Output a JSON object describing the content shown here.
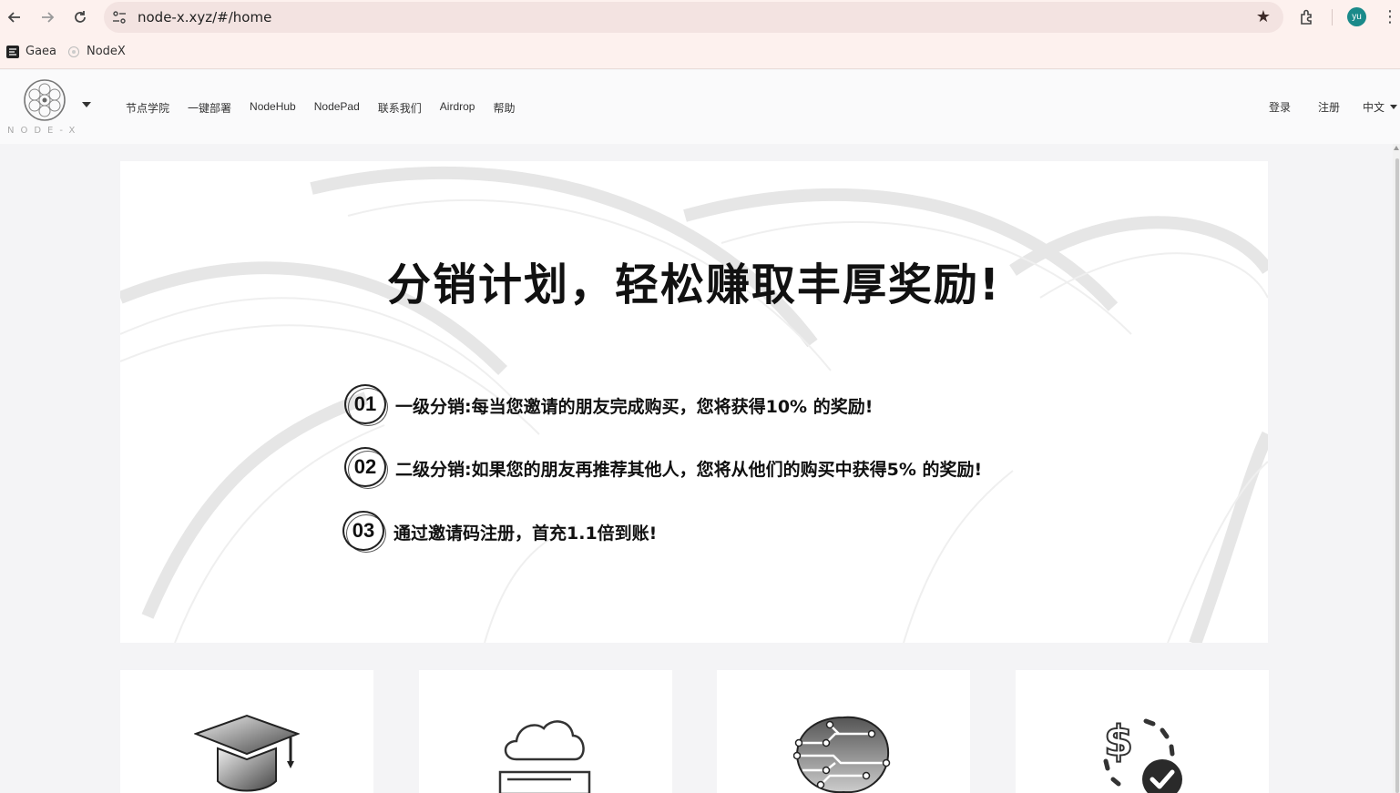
{
  "browser": {
    "url": "node-x.xyz/#/home",
    "profile_initials": "yu",
    "bookmarks": [
      {
        "label": "Gaea",
        "icon": "gaea-favicon"
      },
      {
        "label": "NodeX",
        "icon": "nodex-favicon"
      }
    ]
  },
  "header": {
    "logo_text": "NODE-X",
    "nav": [
      "节点学院",
      "一键部署",
      "NodeHub",
      "NodePad",
      "联系我们",
      "Airdrop",
      "帮助"
    ],
    "login": "登录",
    "register": "注册",
    "language": "中文"
  },
  "banner": {
    "title": "分销计划，轻松赚取丰厚奖励!",
    "steps": [
      {
        "num": "01",
        "text": "一级分销:每当您邀请的朋友完成购买，您将获得10% 的奖励!"
      },
      {
        "num": "02",
        "text": "二级分销:如果您的朋友再推荐其他人，您将从他们的购买中获得5% 的奖励!"
      },
      {
        "num": "03",
        "text": "通过邀请码注册，首充1.1倍到账!"
      }
    ]
  },
  "cards": [
    {
      "icon": "graduation-cap-icon"
    },
    {
      "icon": "cloud-server-icon"
    },
    {
      "icon": "circuit-brain-icon"
    },
    {
      "icon": "dollar-check-icon"
    }
  ],
  "colors": {
    "avatar": "#1a8a8a",
    "chrome": "#fdf1ee",
    "omnibox": "#f3e3e1"
  }
}
